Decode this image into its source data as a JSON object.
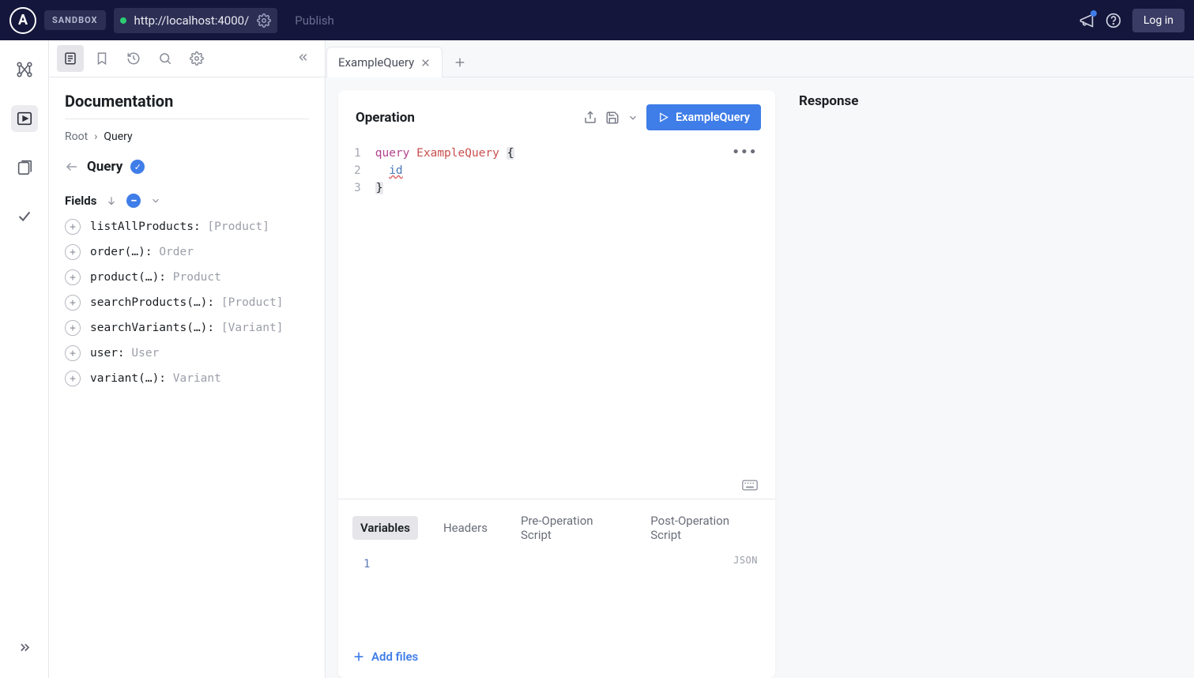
{
  "topbar": {
    "sandbox_label": "SANDBOX",
    "url": "http://localhost:4000/",
    "publish_label": "Publish",
    "login_label": "Log in"
  },
  "docpanel": {
    "title": "Documentation",
    "breadcrumb_root": "Root",
    "breadcrumb_current": "Query",
    "type_name": "Query",
    "fields_label": "Fields",
    "fields": [
      {
        "name": "listAllProducts:",
        "type": "[Product]"
      },
      {
        "name": "order(…):",
        "type": "Order"
      },
      {
        "name": "product(…):",
        "type": "Product"
      },
      {
        "name": "searchProducts(…):",
        "type": "[Product]"
      },
      {
        "name": "searchVariants(…):",
        "type": "[Variant]"
      },
      {
        "name": "user:",
        "type": "User"
      },
      {
        "name": "variant(…):",
        "type": "Variant"
      }
    ]
  },
  "tabs": {
    "active_tab_label": "ExampleQuery"
  },
  "operation": {
    "title": "Operation",
    "run_label": "ExampleQuery",
    "code": {
      "line1_kw": "query",
      "line1_name": "ExampleQuery",
      "line1_brace": "{",
      "line2_field": "id",
      "line3_brace": "}",
      "ln1": "1",
      "ln2": "2",
      "ln3": "3"
    }
  },
  "vars": {
    "tabs": [
      "Variables",
      "Headers",
      "Pre-Operation Script",
      "Post-Operation Script"
    ],
    "json_label": "JSON",
    "line1": "1",
    "add_files_label": "Add files"
  },
  "response": {
    "title": "Response"
  }
}
